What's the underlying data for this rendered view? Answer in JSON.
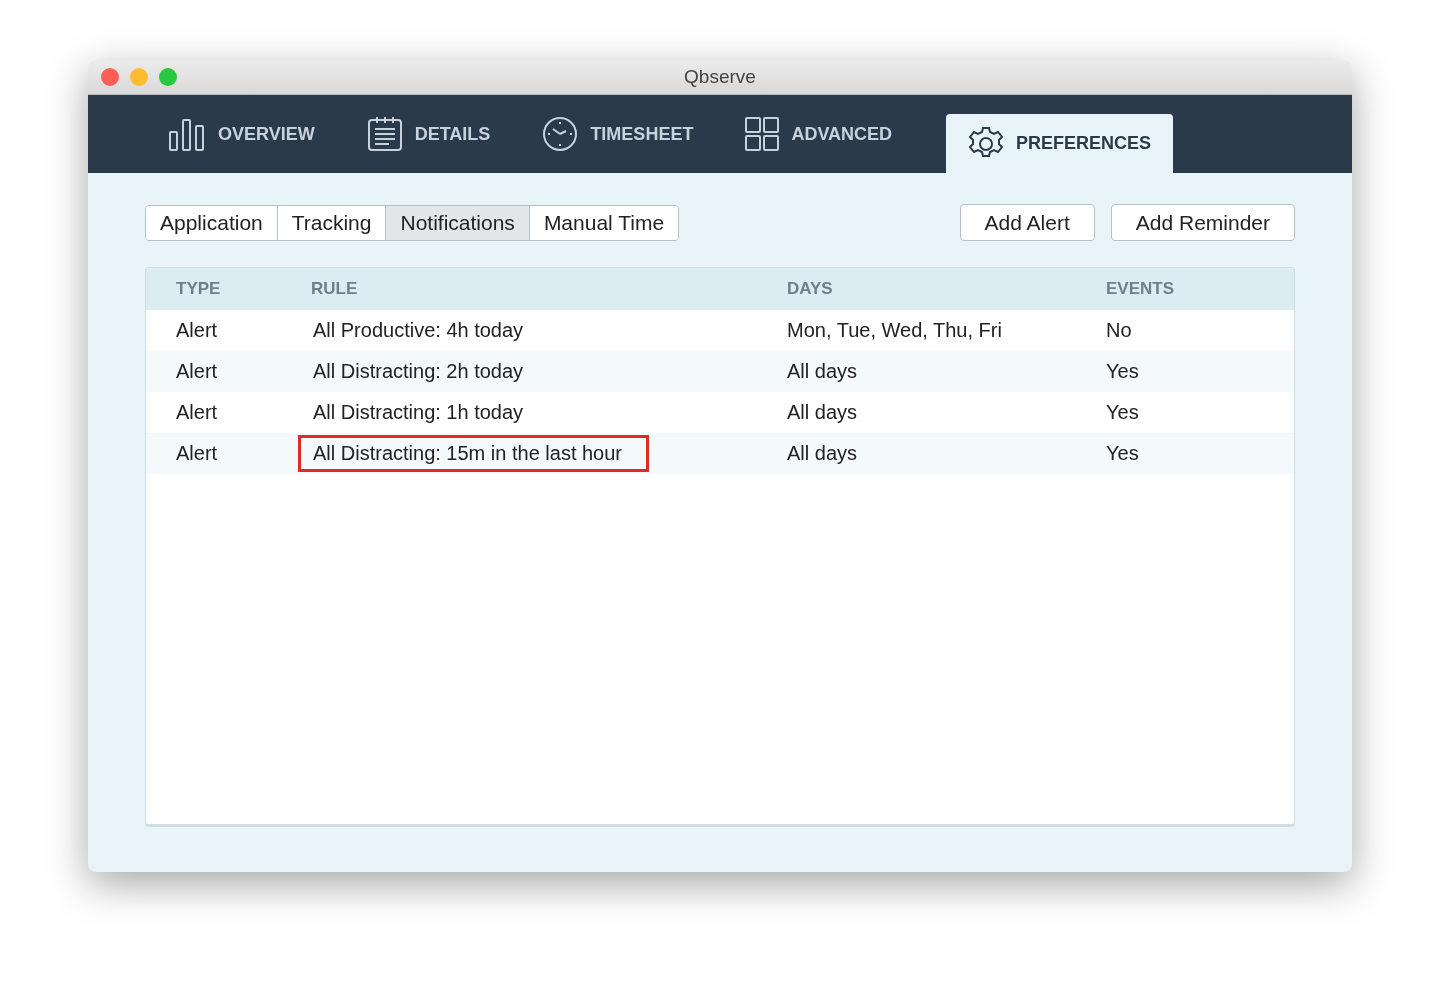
{
  "window": {
    "title": "Qbserve"
  },
  "nav_tabs": [
    {
      "label": "OVERVIEW",
      "kind": "bars",
      "selected": false
    },
    {
      "label": "DETAILS",
      "kind": "list",
      "selected": false
    },
    {
      "label": "TIMESHEET",
      "kind": "clock",
      "selected": false
    },
    {
      "label": "ADVANCED",
      "kind": "grid",
      "selected": false
    },
    {
      "label": "PREFERENCES",
      "kind": "gear",
      "selected": true
    }
  ],
  "sub_tabs": [
    {
      "label": "Application",
      "selected": false
    },
    {
      "label": "Tracking",
      "selected": false
    },
    {
      "label": "Notifications",
      "selected": true
    },
    {
      "label": "Manual Time",
      "selected": false
    }
  ],
  "buttons": [
    "Add Alert",
    "Add Reminder"
  ],
  "table": {
    "columns": [
      "TYPE",
      "RULE",
      "DAYS",
      "EVENTS"
    ],
    "rows": [
      {
        "type": "Alert",
        "rule": "All Productive: 4h today",
        "days": "Mon, Tue, Wed, Thu, Fri",
        "events": "No",
        "highlighted": false
      },
      {
        "type": "Alert",
        "rule": "All Distracting: 2h today",
        "days": "All days",
        "events": "Yes",
        "highlighted": false
      },
      {
        "type": "Alert",
        "rule": "All Distracting: 1h today",
        "days": "All days",
        "events": "Yes",
        "highlighted": false
      },
      {
        "type": "Alert",
        "rule": "All Distracting: 15m in the last hour",
        "days": "All days",
        "events": "Yes",
        "highlighted": true
      }
    ]
  }
}
